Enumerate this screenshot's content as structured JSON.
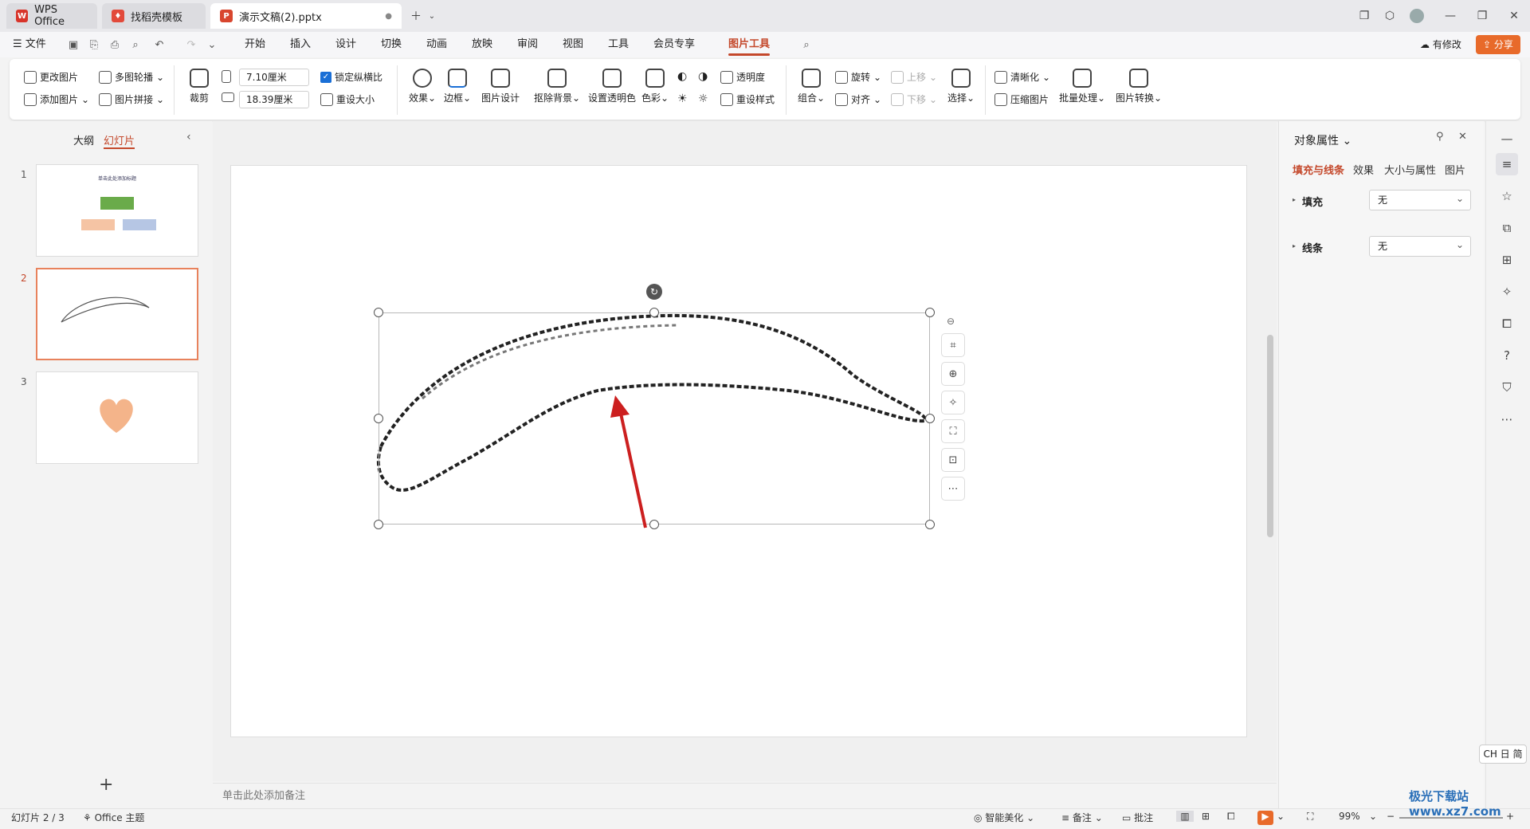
{
  "tabs": [
    {
      "label": "WPS Office"
    },
    {
      "label": "找稻壳模板"
    },
    {
      "label": "演示文稿(2).pptx"
    }
  ],
  "menu": {
    "file": "文件",
    "items": [
      "开始",
      "插入",
      "设计",
      "切换",
      "动画",
      "放映",
      "审阅",
      "视图",
      "工具",
      "会员专享",
      "图片工具"
    ],
    "active": "图片工具",
    "modify": "有修改",
    "share": "分享"
  },
  "ribbon": {
    "change_pic": "更改图片",
    "multi_carousel": "多图轮播",
    "add_pic": "添加图片",
    "pic_collage": "图片拼接",
    "crop": "裁剪",
    "height_value": "7.10厘米",
    "width_value": "18.39厘米",
    "lock_ratio": "锁定纵横比",
    "reset_size": "重设大小",
    "effects": "效果",
    "border": "边框",
    "pic_design": "图片设计",
    "remove_bg": "抠除背景",
    "set_transparent": "设置透明色",
    "color": "色彩",
    "transparency": "透明度",
    "reset_style": "重设样式",
    "group": "组合",
    "rotate": "旋转",
    "align": "对齐",
    "move_up": "上移",
    "move_down": "下移",
    "select": "选择",
    "sharpen": "清晰化",
    "compress": "压缩图片",
    "batch": "批量处理",
    "convert": "图片转换"
  },
  "leftpanel": {
    "outline_tab": "大纲",
    "slides_tab": "幻灯片",
    "slide_numbers": [
      "1",
      "2",
      "3"
    ],
    "slide1_title": "单击此处添加标题"
  },
  "notes_placeholder": "单击此处添加备注",
  "rightpanel": {
    "title": "对象属性",
    "tabs": [
      "填充与线条",
      "效果",
      "大小与属性",
      "图片"
    ],
    "fill_label": "填充",
    "fill_value": "无",
    "line_label": "线条",
    "line_value": "无"
  },
  "ime": "CH ⽇ 简",
  "status": {
    "slide_info": "幻灯片 2 / 3",
    "theme": "Office 主题",
    "beautify": "智能美化",
    "notes": "备注",
    "comments": "批注",
    "zoom": "99%"
  },
  "watermark": "极光下载站 www.xz7.com",
  "colors": {
    "accent": "#c4482b",
    "share_bg": "#e86a2a",
    "heart": "#f4b48a",
    "arrow": "#cc1f1f"
  }
}
